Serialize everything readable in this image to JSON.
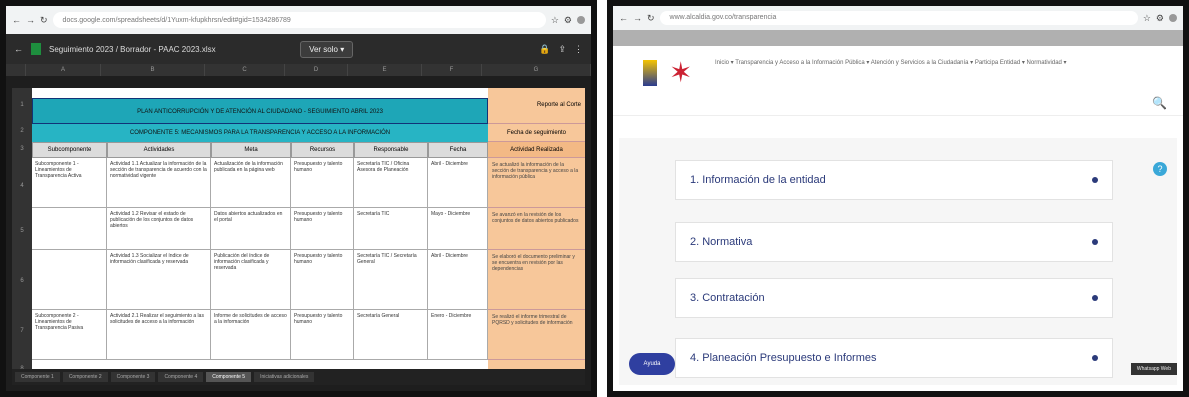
{
  "left": {
    "browser_url": "docs.google.com/spreadsheets/d/1Yuxm-kfupkhrsn/edit#gid=1534286789",
    "sheet_title": "Seguimiento 2023 / Borrador - PAAC 2023.xlsx",
    "edit_button": "Ver solo ▾",
    "columns": [
      "A",
      "B",
      "C",
      "D",
      "E",
      "F",
      "G",
      "H"
    ],
    "rows": [
      "1",
      "2",
      "3",
      "4",
      "5",
      "6",
      "7",
      "8"
    ],
    "banner1": "PLAN ANTICORRUPCIÓN Y DE ATENCIÓN AL CIUDADANO - SEGUIMIENTO ABRIL 2023",
    "banner2": "COMPONENTE 5: MECANISMOS PARA LA TRANSPARENCIA Y ACCESO A LA INFORMACIÓN",
    "headers": [
      "Subcomponente",
      "Actividades",
      "Meta",
      "Recursos",
      "Responsable",
      "Fecha"
    ],
    "orange_title": "Reporte al Corte",
    "orange_sub": "Fecha de seguimiento",
    "orange_hdr": "Actividad Realizada",
    "table_rows": [
      {
        "sub": "Subcomponente 1 - Lineamientos de Transparencia Activa",
        "act": "Actividad 1.1 Actualizar la información de la sección de transparencia de acuerdo con la normatividad vigente",
        "meta": "Actualización de la información publicada en la página web",
        "rec": "Presupuesto y talento humano",
        "resp": "Secretaría TIC / Oficina Asesora de Planeación",
        "fecha": "Abril - Diciembre",
        "obs": "Se actualizó la información de la sección de transparencia y acceso a la información pública"
      },
      {
        "sub": "",
        "act": "Actividad 1.2 Revisar el estado de publicación de los conjuntos de datos abiertos",
        "meta": "Datos abiertos actualizados en el portal",
        "rec": "Presupuesto y talento humano",
        "resp": "Secretaría TIC",
        "fecha": "Mayo - Diciembre",
        "obs": "Se avanzó en la revisión de los conjuntos de datos abiertos publicados"
      },
      {
        "sub": "",
        "act": "Actividad 1.3 Socializar el índice de información clasificada y reservada",
        "meta": "Publicación del índice de información clasificada y reservada",
        "rec": "Presupuesto y talento humano",
        "resp": "Secretaría TIC / Secretaría General",
        "fecha": "Abril - Diciembre",
        "obs": "Se elaboró el documento preliminar y se encuentra en revisión por las dependencias"
      },
      {
        "sub": "Subcomponente 2 - Lineamientos de Transparencia Pasiva",
        "act": "Actividad 2.1 Realizar el seguimiento a las solicitudes de acceso a la información",
        "meta": "Informe de solicitudes de acceso a la información",
        "rec": "Presupuesto y talento humano",
        "resp": "Secretaría General",
        "fecha": "Enero - Diciembre",
        "obs": "Se realizó el informe trimestral de PQRSD y solicitudes de información"
      }
    ],
    "sheet_tabs": [
      "Componente 1",
      "Componente 2",
      "Componente 3",
      "Componente 4",
      "Componente 5",
      "Iniciativas adicionales"
    ],
    "active_tab_index": 4
  },
  "right": {
    "browser_url": "www.alcaldia.gov.co/transparencia",
    "nav_text": "Inicio ▾   Transparencia y Acceso a la Información Pública ▾   Atención y Servicios a la Ciudadanía ▾   Participa   Entidad ▾   Normatividad ▾",
    "accordion": [
      "1. Información de la entidad",
      "2. Normativa",
      "3. Contratación",
      "4. Planeación Presupuesto e Informes"
    ],
    "help_icon": "?",
    "ayuda_label": "Ayuda",
    "tooltip": "Whatsapp Web"
  }
}
